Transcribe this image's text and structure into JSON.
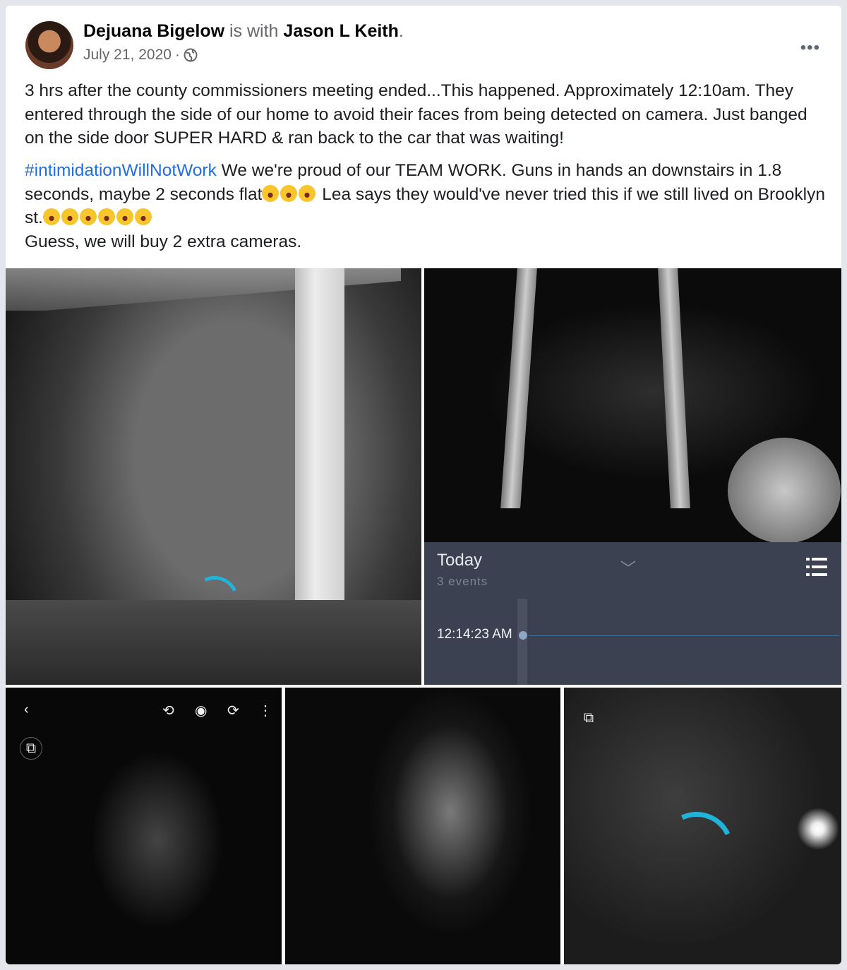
{
  "post": {
    "author": "Dejuana Bigelow",
    "with_text": "is with",
    "tagged": "Jason L Keith",
    "period": ".",
    "date": "July 21, 2020",
    "separator": "·",
    "more_icon": "more-horizontal-icon",
    "audience_icon": "globe-icon",
    "paragraph1": "3 hrs after the county commissioners meeting ended...This happened. Approximately 12:10am. They entered through the side of our home to avoid their faces from being detected on camera. Just banged on the side door SUPER HARD & ran back to the car that was waiting!",
    "hashtag": "#intimidationWillNotWork",
    "paragraph2a": " We we're proud of our TEAM WORK. Guns in hands an downstairs in 1.8 seconds, maybe 2 seconds flat",
    "paragraph2b": " Lea says they would've never tried this if we still lived on Brooklyn st.",
    "paragraph3": "Guess, we will buy 2 extra cameras."
  },
  "camera_app": {
    "today_label": "Today",
    "events_label": "3 events",
    "event_time": "12:14:23 AM"
  },
  "colors": {
    "hashtag": "#216fdb",
    "spinner": "#21b3d8",
    "panel": "#3b4150"
  }
}
